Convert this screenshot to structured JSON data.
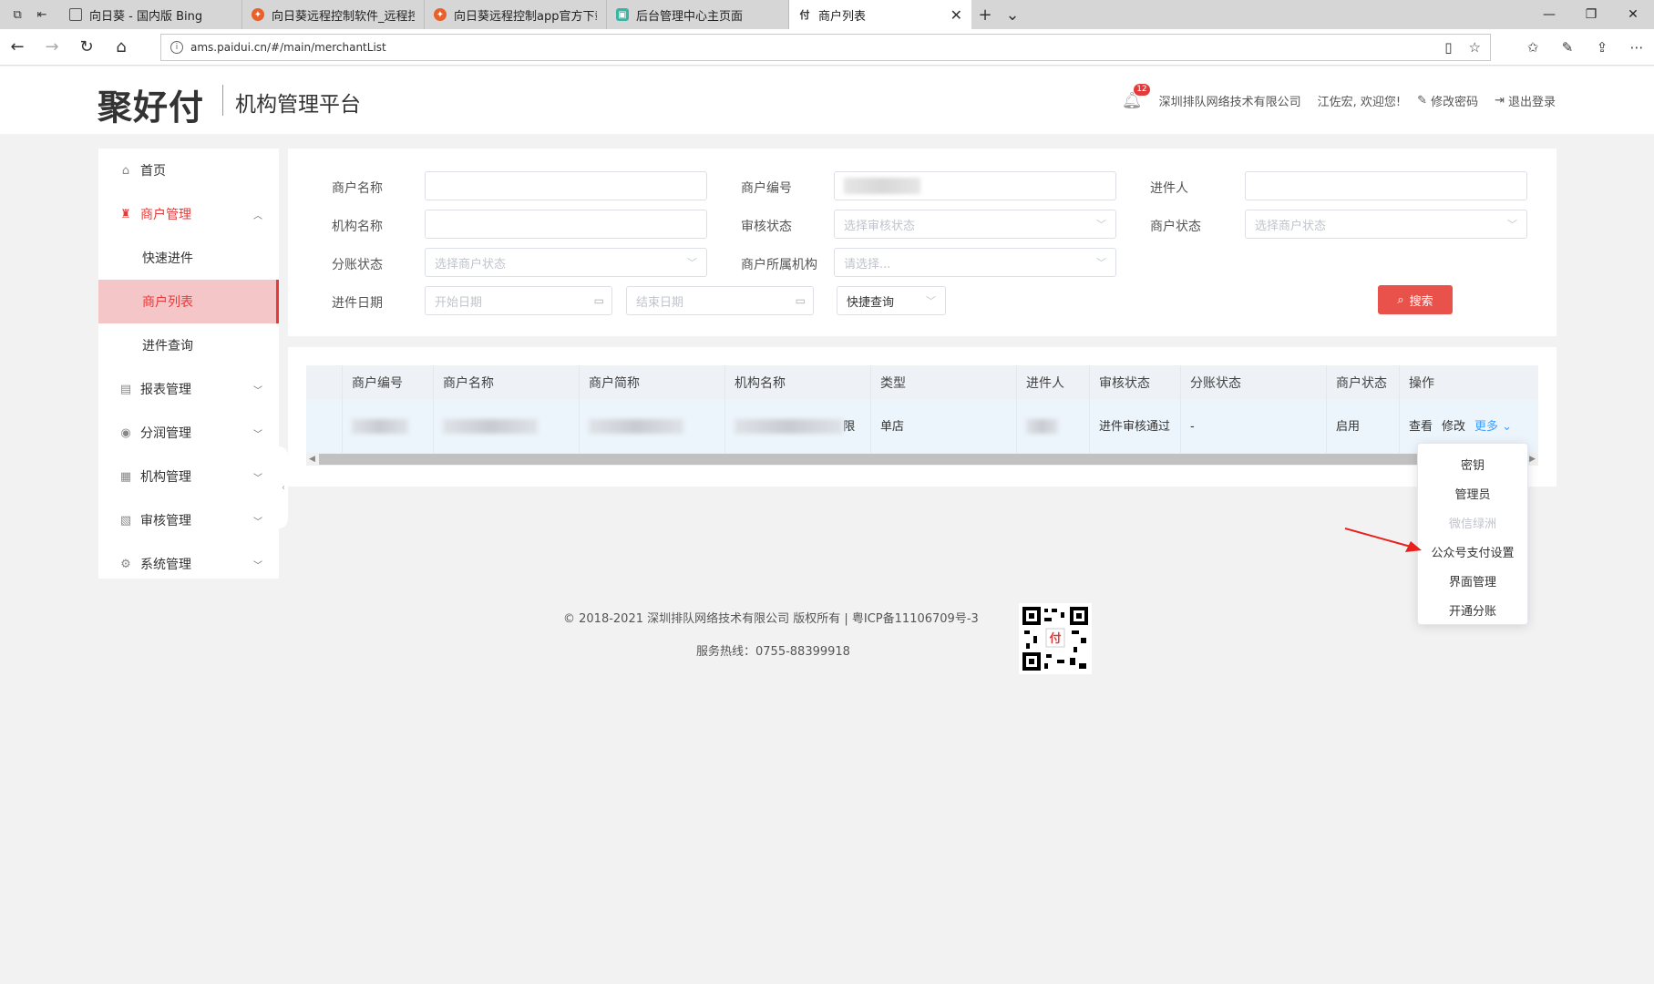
{
  "browser": {
    "tabs": [
      {
        "title": "向日葵 - 国内版 Bing",
        "icon": "page-icon"
      },
      {
        "title": "向日葵远程控制软件_远程控",
        "icon": "sunlogin-icon"
      },
      {
        "title": "向日葵远程控制app官方下载",
        "icon": "sunlogin-icon"
      },
      {
        "title": "后台管理中心主页面",
        "icon": "admin-icon"
      },
      {
        "title": "商户列表",
        "icon": "pay-icon",
        "active": true
      }
    ],
    "url": "ams.paidui.cn/#/main/merchantList"
  },
  "header": {
    "logo_text": "聚好付",
    "platform_title": "机构管理平台",
    "notification_count": "12",
    "company": "深圳排队网络技术有限公司",
    "welcome": "江佐宏, 欢迎您!",
    "change_password": "修改密码",
    "logout": "退出登录"
  },
  "sidebar": {
    "home": "首页",
    "merchant_mgmt": "商户管理",
    "merchant_sub": [
      "快速进件",
      "商户列表",
      "进件查询"
    ],
    "report_mgmt": "报表管理",
    "profit_mgmt": "分润管理",
    "org_mgmt": "机构管理",
    "audit_mgmt": "审核管理",
    "system_mgmt": "系统管理"
  },
  "filters": {
    "merchant_name_label": "商户名称",
    "merchant_no_label": "商户编号",
    "entrant_label": "进件人",
    "org_name_label": "机构名称",
    "audit_status_label": "审核状态",
    "audit_status_placeholder": "选择审核状态",
    "merchant_status_label": "商户状态",
    "merchant_status_placeholder": "选择商户状态",
    "split_status_label": "分账状态",
    "split_status_placeholder": "选择商户状态",
    "merchant_org_label": "商户所属机构",
    "merchant_org_placeholder": "请选择...",
    "entry_date_label": "进件日期",
    "start_date_placeholder": "开始日期",
    "end_date_placeholder": "结束日期",
    "quick_query": "快捷查询",
    "search_button": "搜索"
  },
  "table": {
    "columns": [
      "",
      "商户编号",
      "商户名称",
      "商户简称",
      "机构名称",
      "类型",
      "进件人",
      "审核状态",
      "分账状态",
      "商户状态",
      "操作"
    ],
    "row": {
      "org_name_suffix": "限",
      "type": "单店",
      "audit_status": "进件审核通过",
      "split_status": "-",
      "merchant_status": "启用",
      "ops": {
        "view": "查看",
        "edit": "修改",
        "more": "更多"
      }
    }
  },
  "dropdown": {
    "items": [
      {
        "label": "密钥",
        "disabled": false
      },
      {
        "label": "管理员",
        "disabled": false
      },
      {
        "label": "微信绿洲",
        "disabled": true
      },
      {
        "label": "公众号支付设置",
        "disabled": false
      },
      {
        "label": "界面管理",
        "disabled": false
      },
      {
        "label": "开通分账",
        "disabled": false
      }
    ]
  },
  "footer": {
    "copyright": "© 2018-2021 深圳排队网络技术有限公司 版权所有 | 粤ICP备11106709号-3",
    "hotline": "服务热线：0755-88399918"
  },
  "colors": {
    "accent": "#e63a3a",
    "active_bg": "#f5c6c8",
    "link": "#409eff",
    "search_btn": "#e8524a"
  }
}
